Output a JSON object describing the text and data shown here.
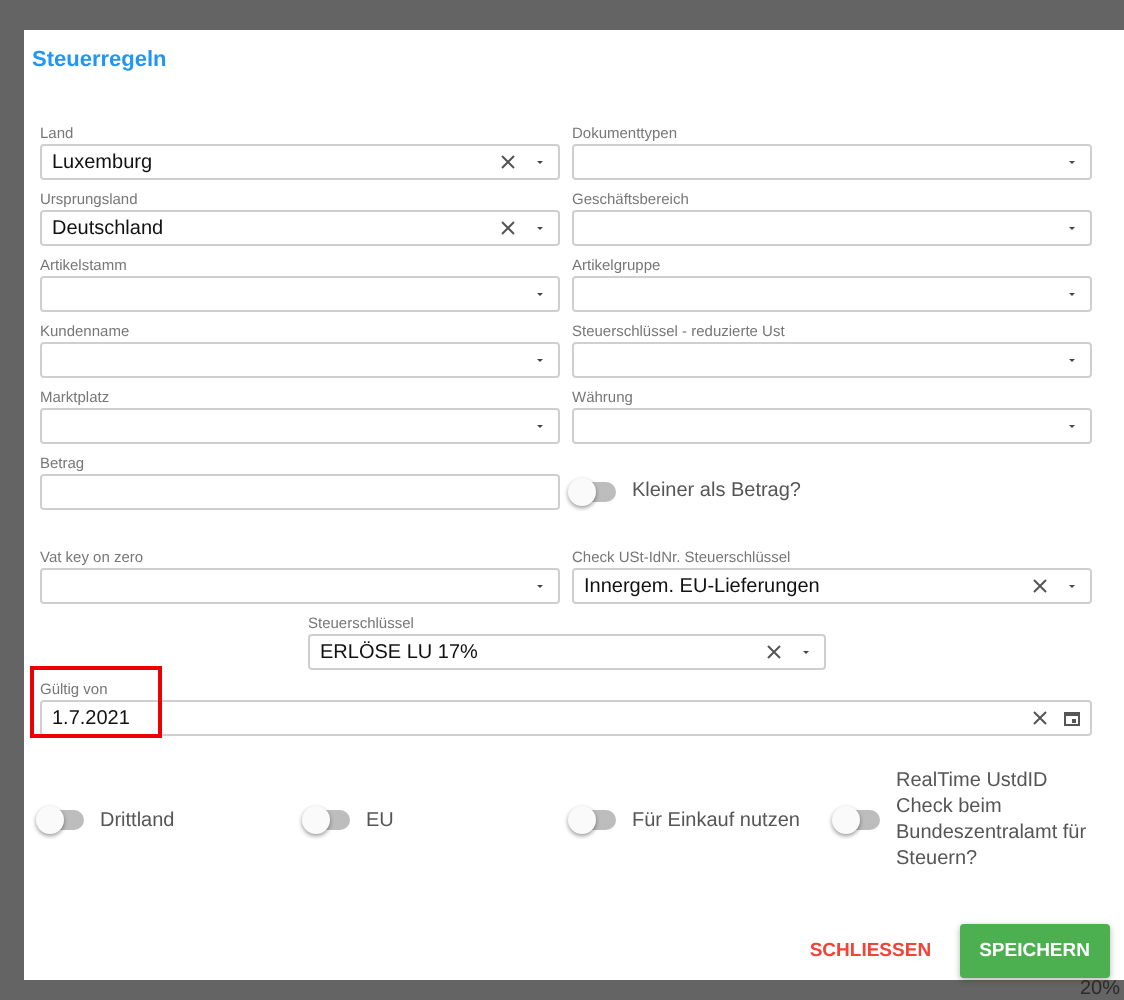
{
  "dialog": {
    "title": "Steuerregeln"
  },
  "grid_fields": [
    {
      "label": "Land",
      "value": "Luxemburg",
      "clearable": true
    },
    {
      "label": "Dokumenttypen",
      "clearable": false
    },
    {
      "label": "Ursprungsland",
      "value": "Deutschland",
      "clearable": true
    },
    {
      "label": "Geschäftsbereich",
      "clearable": false
    },
    {
      "label": "Artikelstamm",
      "clearable": false
    },
    {
      "label": "Artikelgruppe",
      "clearable": false
    },
    {
      "label": "Kundenname",
      "clearable": false
    },
    {
      "label": "Steuerschlüssel - reduzierte Ust",
      "clearable": false
    },
    {
      "label": "Marktplatz",
      "clearable": false
    },
    {
      "label": "Währung",
      "clearable": false
    }
  ],
  "betrag": {
    "label": "Betrag"
  },
  "betrag_toggle": {
    "label": "Kleiner als Betrag?",
    "on": false
  },
  "vat_fields": [
    {
      "label": "Vat key on zero",
      "clearable": false
    },
    {
      "label": "Check USt-IdNr. Steuerschlüssel",
      "value": "Innergem. EU-Lieferungen",
      "clearable": true
    }
  ],
  "steuerschluessel": {
    "label": "Steuerschlüssel",
    "value": "ERLÖSE LU 17%",
    "clearable": true
  },
  "gueltig_von": {
    "label": "Gültig von",
    "value": "1.7.2021",
    "clearable": true,
    "highlighted": true
  },
  "toggles": [
    {
      "label": "Drittland",
      "on": false
    },
    {
      "label": "EU",
      "on": false
    },
    {
      "label": "Für Einkauf nutzen",
      "on": false
    },
    {
      "label": "RealTime UstdID Check beim Bundeszentralamt für Steuern?",
      "on": false
    }
  ],
  "buttons": [
    {
      "label": "SCHLIESSEN",
      "kind": "text"
    },
    {
      "label": "SPEICHERN",
      "kind": "primary"
    }
  ],
  "background": {
    "text": "20%"
  }
}
